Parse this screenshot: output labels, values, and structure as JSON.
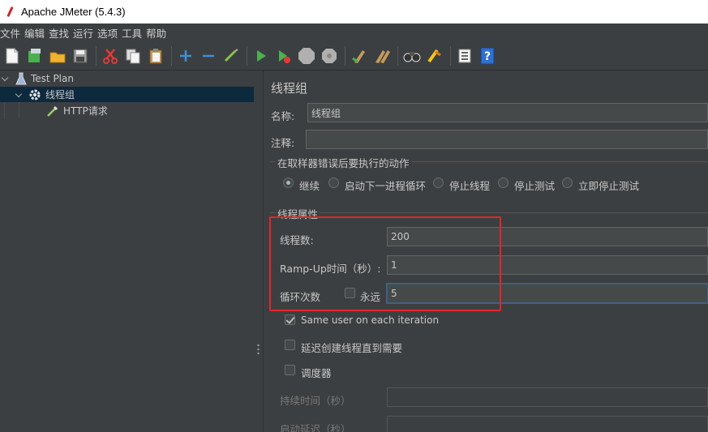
{
  "window": {
    "title": "Apache JMeter (5.4.3)"
  },
  "menu": [
    "文件",
    "编辑",
    "查找",
    "运行",
    "选项",
    "工具",
    "帮助"
  ],
  "toolbar": {
    "icons": [
      "new-icon",
      "templates-icon",
      "open-icon",
      "save-icon",
      "cut-icon",
      "copy-icon",
      "paste-icon",
      "expand-icon",
      "collapse-icon",
      "toggle-icon",
      "start-icon",
      "start-no-pause-icon",
      "stop-icon",
      "shutdown-icon",
      "clear-icon",
      "clear-all-icon",
      "search-icon",
      "reset-search-icon",
      "function-helper-icon",
      "help-icon"
    ],
    "colors": {
      "start": "#4caf50",
      "add": "#3d8fd8"
    }
  },
  "tree": {
    "items": [
      {
        "label": "Test Plan",
        "icon": "test-plan-icon"
      },
      {
        "label": "线程组",
        "icon": "gear-icon"
      },
      {
        "label": "HTTP请求",
        "icon": "pipette-icon"
      }
    ]
  },
  "panel": {
    "title": "线程组",
    "name_label": "名称:",
    "name_value": "线程组",
    "comment_label": "注释:",
    "comment_value": "",
    "on_error": {
      "title": "在取样器错误后要执行的动作",
      "options": [
        "继续",
        "启动下一进程循环",
        "停止线程",
        "停止测试",
        "立即停止测试"
      ],
      "selected": "继续"
    },
    "thread_props": {
      "title": "线程属性",
      "threads_label": "线程数:",
      "threads_value": "200",
      "rampup_label": "Ramp-Up时间（秒）:",
      "rampup_value": "1",
      "loop_label": "循环次数",
      "forever_label": "永远",
      "forever_checked": false,
      "loop_value": "5",
      "same_user_label": "Same user on each iteration",
      "same_user_checked": true,
      "delay_label": "延迟创建线程直到需要",
      "delay_checked": false,
      "scheduler_label": "调度器",
      "scheduler_checked": false,
      "duration_label": "持续时间（秒）",
      "startup_delay_label": "启动延迟（秒）"
    }
  },
  "annotation": {
    "color": "#e5252a"
  }
}
